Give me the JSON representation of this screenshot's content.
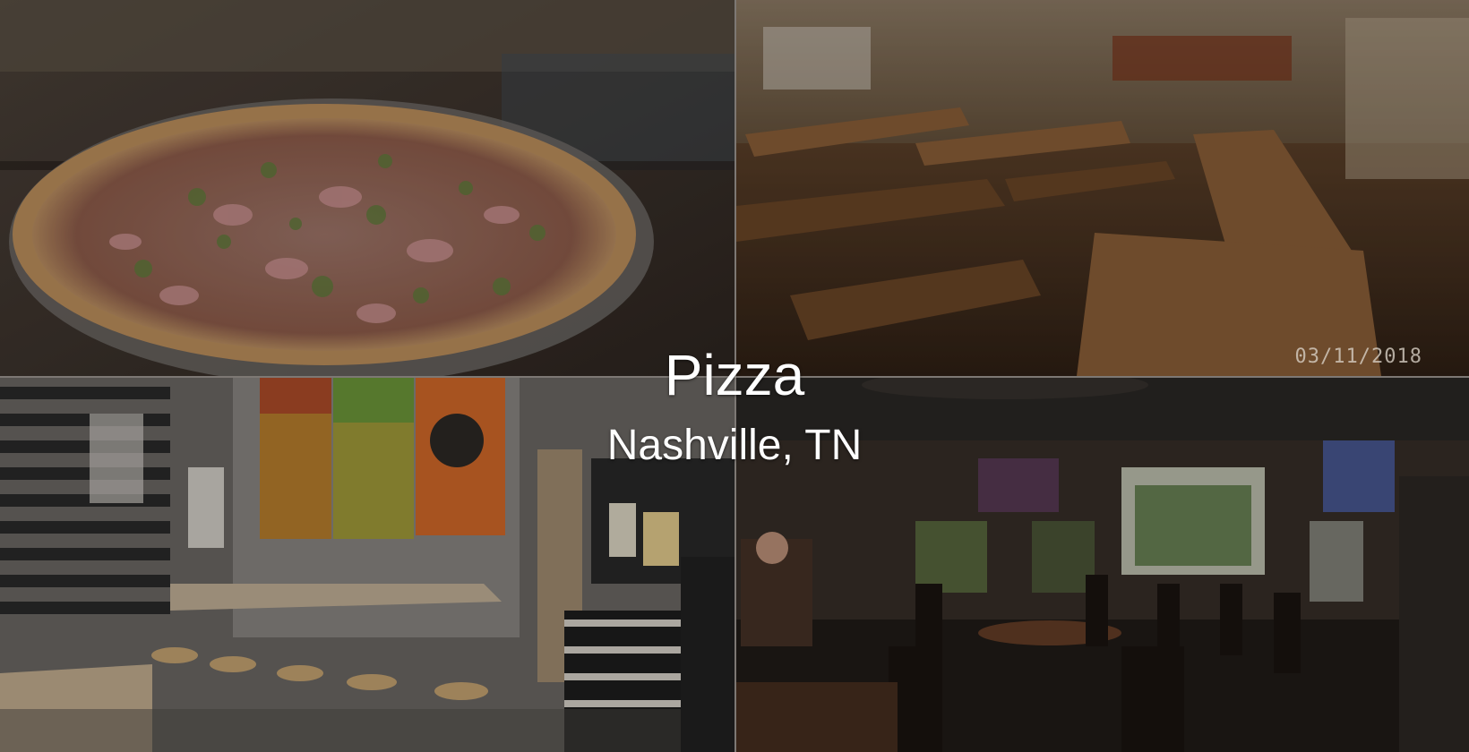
{
  "overlay": {
    "title": "Pizza",
    "subtitle": "Nashville, TN"
  },
  "photos": {
    "top_left": "pizza-on-wooden-table",
    "top_right": "restaurant-interior-with-long-tables",
    "bottom_left": "counter-with-stools-and-murals",
    "bottom_right": "bar-dining-room-with-tvs",
    "date_stamp": "03/11/2018"
  },
  "colors": {
    "text": "#ffffff",
    "divider": "#cfcac2"
  }
}
